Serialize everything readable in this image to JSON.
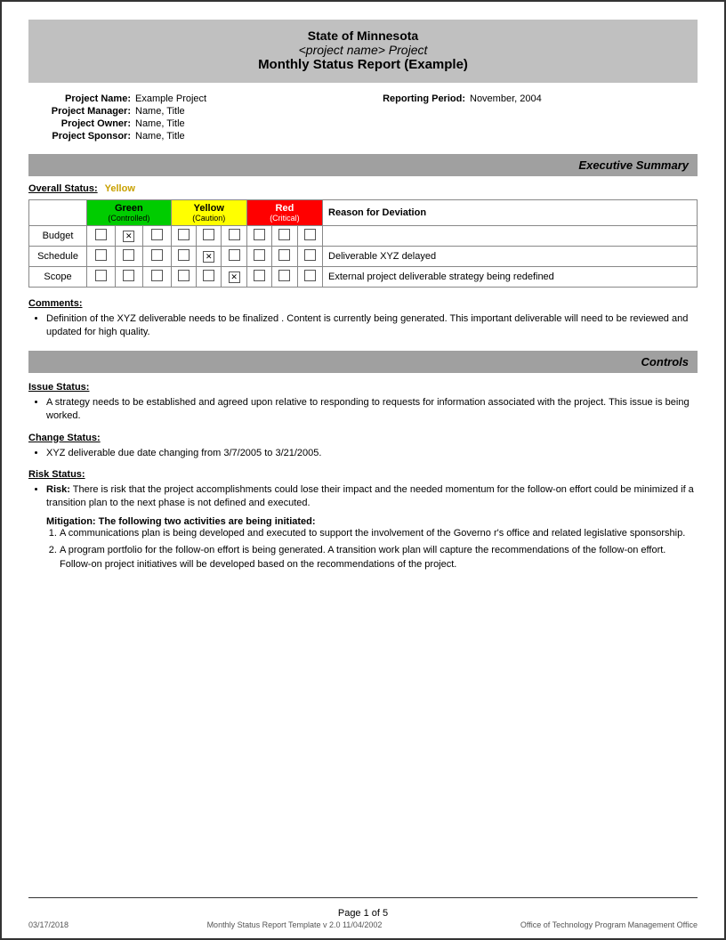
{
  "header": {
    "line1": "State of Minnesota",
    "line2": "<project name> Project",
    "line3": "Monthly Status Report (Example)"
  },
  "project_info": {
    "name_label": "Project Name:",
    "name_value": "Example Project",
    "reporting_label": "Reporting Period:",
    "reporting_value": "November, 2004",
    "manager_label": "Project Manager:",
    "manager_value": "Name, Title",
    "owner_label": "Project Owner:",
    "owner_value": "Name, Title",
    "sponsor_label": "Project Sponsor:",
    "sponsor_value": "Name, Title"
  },
  "executive_summary": {
    "section_title": "Executive Summary",
    "overall_status_label": "Overall Status:",
    "overall_status_value": "Yellow",
    "table": {
      "headers": {
        "green": "Green",
        "green_sub": "(Controlled)",
        "yellow": "Yellow",
        "yellow_sub": "(Caution)",
        "red": "Red",
        "red_sub": "(Critical)",
        "reason": "Reason for Deviation"
      },
      "rows": [
        {
          "label": "Budget",
          "green": [
            false,
            true,
            false
          ],
          "yellow": [
            false,
            false,
            false
          ],
          "red": [
            false,
            false,
            false
          ],
          "reason": ""
        },
        {
          "label": "Schedule",
          "green": [
            false,
            false,
            false
          ],
          "yellow": [
            false,
            true,
            false
          ],
          "red": [
            false,
            false,
            false
          ],
          "reason": "Deliverable XYZ delayed"
        },
        {
          "label": "Scope",
          "green": [
            false,
            false,
            false
          ],
          "yellow": [
            false,
            false,
            true
          ],
          "red": [
            false,
            false,
            false
          ],
          "reason": "External project deliverable strategy being redefined"
        }
      ]
    },
    "comments_label": "Comments:",
    "comments_bullet": "Definition of the XYZ deliverable  needs to be finalized .  Content is currently being generated.  This important deliverable will need to be reviewed and updated for high quality."
  },
  "controls": {
    "section_title": "Controls",
    "issue_status_label": "Issue Status:",
    "issue_bullet": "A strategy needs to be established and agreed upon relative to  responding to  requests for information associated with the project.  This issue is being worked.",
    "change_status_label": "Change Status:",
    "change_bullet": "XYZ deliverable due date changing from   3/7/2005 to 3/21/2005.",
    "risk_status_label": "Risk Status:",
    "risk_bullet_label": "Risk:",
    "risk_bullet_text": "There is risk that the project accomplishments could lose their impact and the needed momentum for the follow-on effort could be   minimized if a transition plan to the next phase is not defined and executed.",
    "mitigation_label": "Mitigation:",
    "mitigation_intro": "The following two activities are being initiated:",
    "mitigation_items": [
      "A communications plan is being developed and executed to support the involvement of the Governo r's office and related legislative sponsorship.",
      "A program portfolio for the follow-on effort is being generated.  A transition work plan will capture the recommendations of the follow-on effort. Follow-on project initiatives will be developed based on the recommendations of the project."
    ]
  },
  "footer": {
    "date": "03/17/2018",
    "page": "Page 1 of 5",
    "template_info": "Monthly Status Report Template  v 2.0  11/04/2002",
    "office": "Office of Technology Program Management Office"
  }
}
